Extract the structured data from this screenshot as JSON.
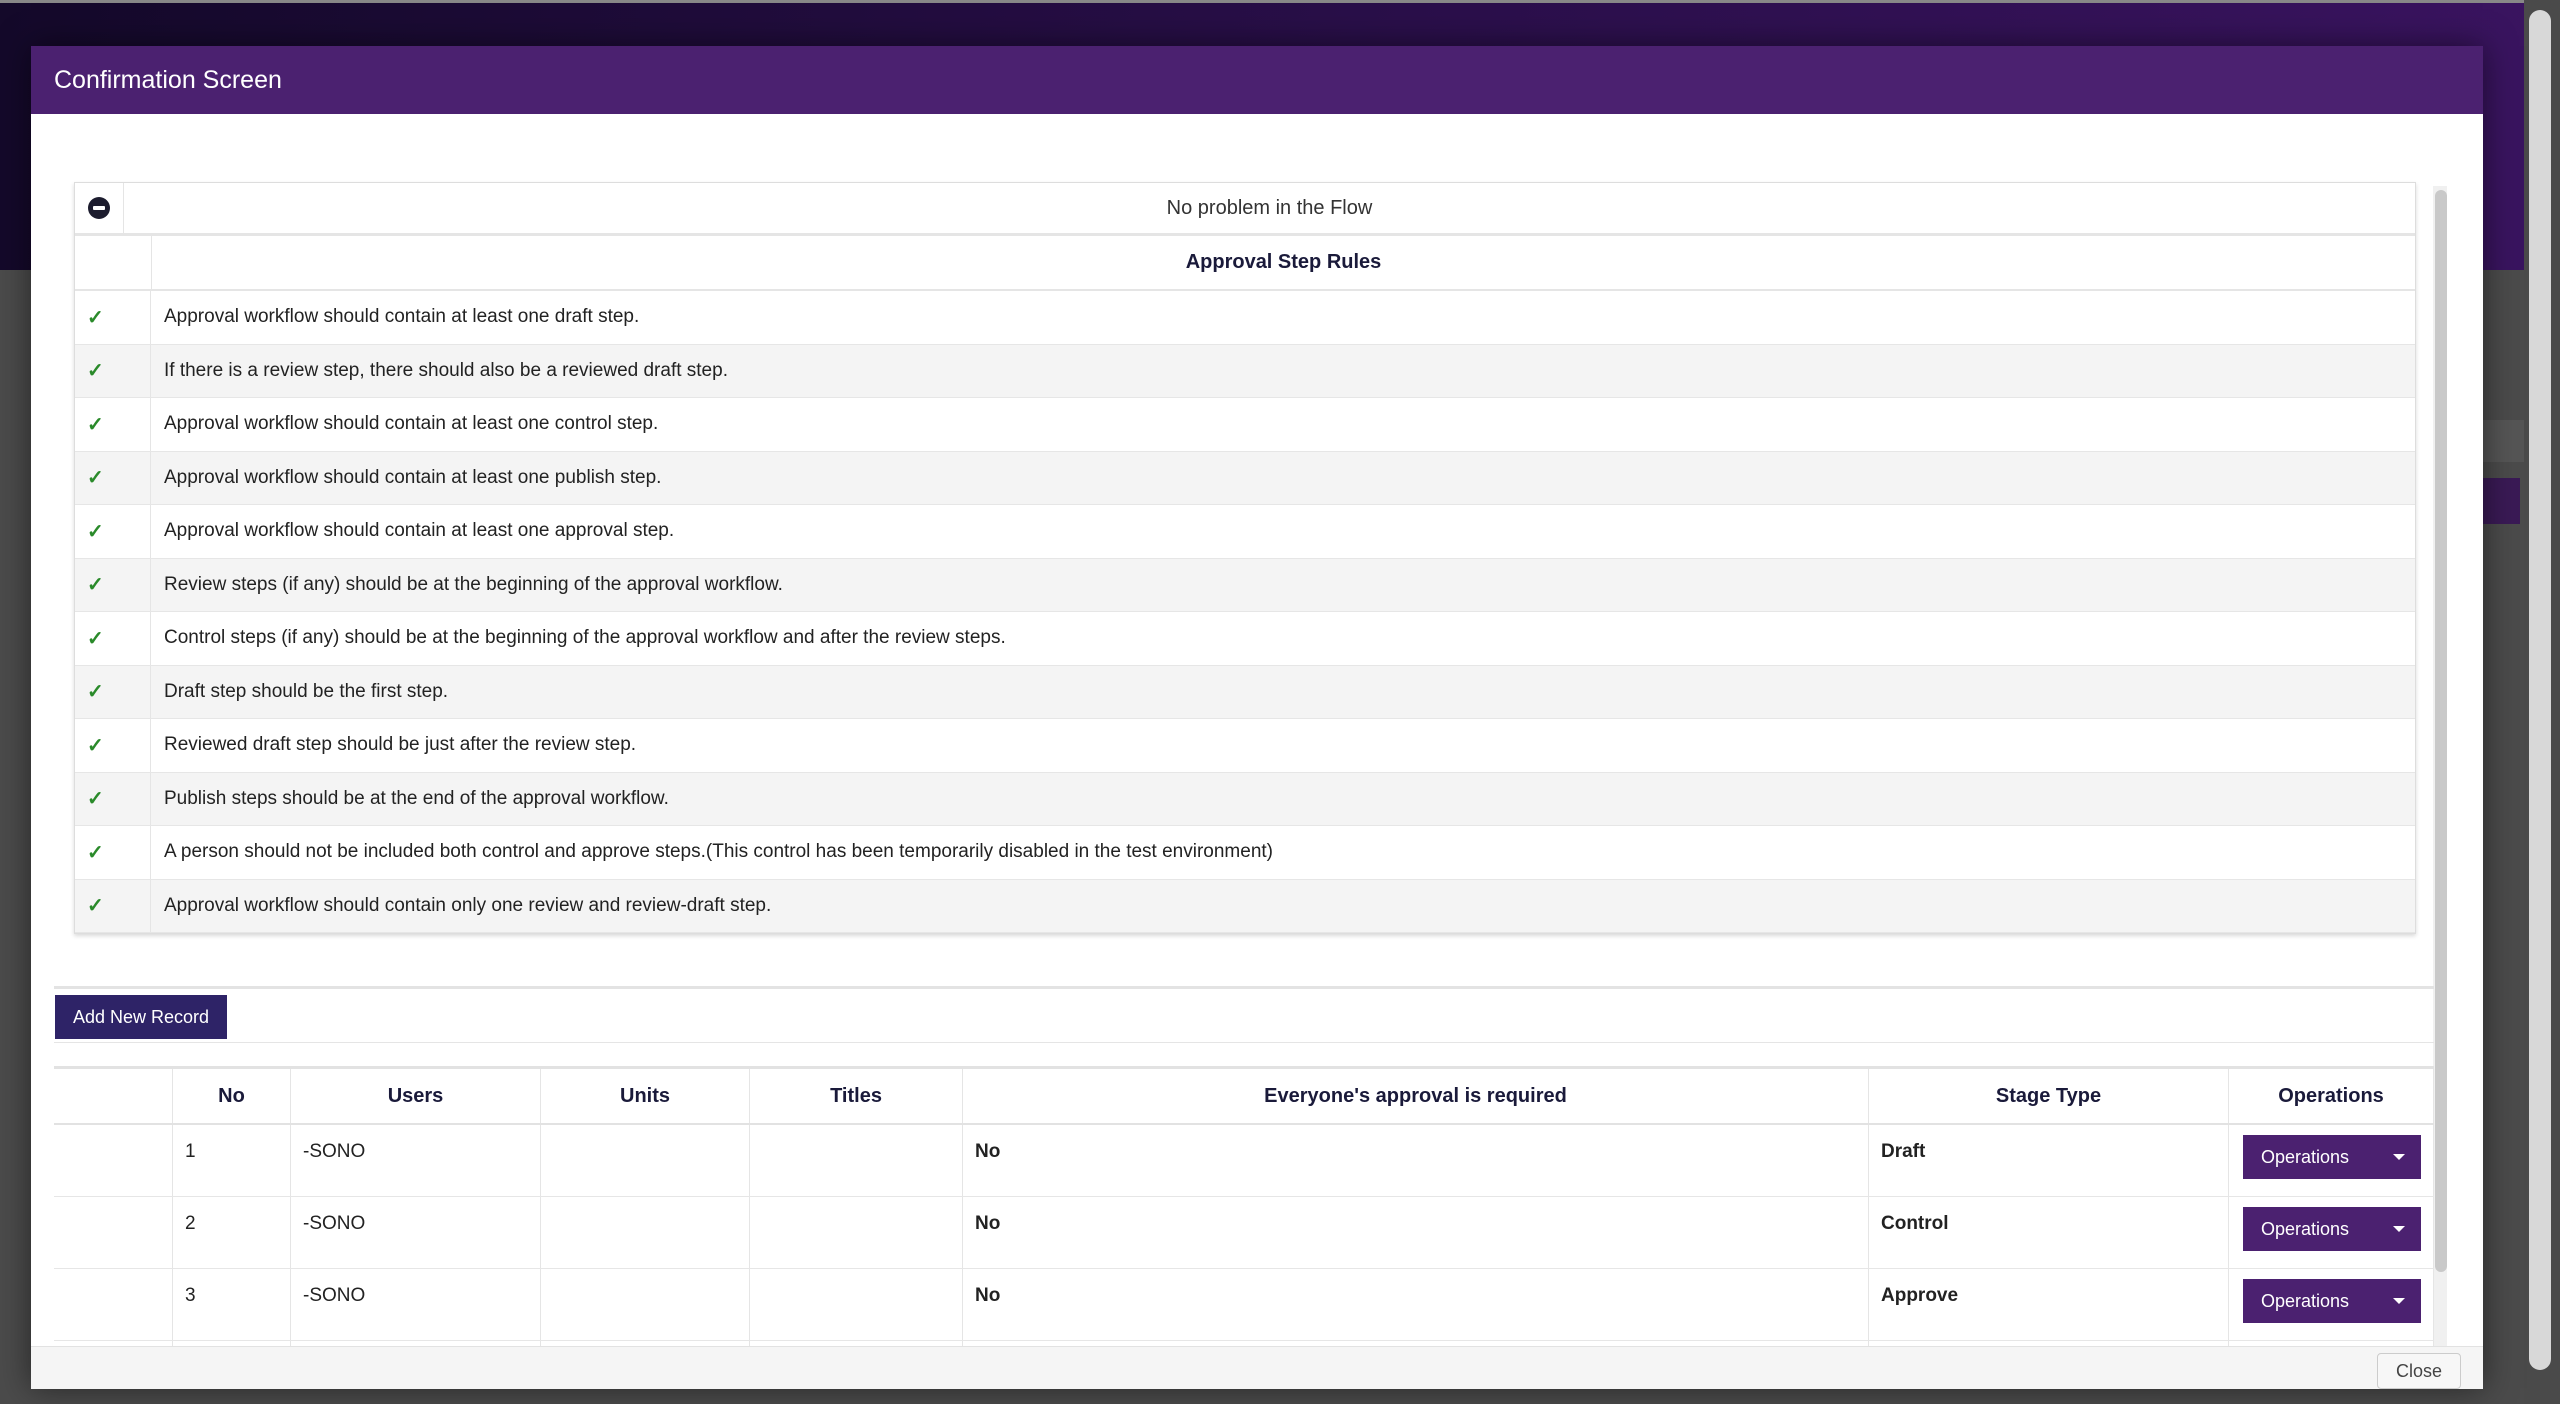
{
  "modal": {
    "title": "Confirmation Screen",
    "close_label": "Close"
  },
  "rules": {
    "status_text": "No problem in the Flow",
    "header": "Approval Step Rules",
    "check_glyph": "✓",
    "items": [
      "Approval workflow should contain at least one draft step.",
      "If there is a review step, there should also be a reviewed draft step.",
      "Approval workflow should contain at least one control step.",
      "Approval workflow should contain at least one publish step.",
      "Approval workflow should contain at least one approval step.",
      "Review steps (if any) should be at the beginning of the approval workflow.",
      "Control steps (if any) should be at the beginning of the approval workflow and after the review steps.",
      "Draft step should be the first step.",
      "Reviewed draft step should be just after the review step.",
      "Publish steps should be at the end of the approval workflow.",
      "A person should not be included both control and approve steps.(This control has been temporarily disabled in the test environment)",
      "Approval workflow should contain only one review and review-draft step."
    ]
  },
  "records": {
    "add_label": "Add New Record",
    "columns": [
      "",
      "No",
      "Users",
      "Units",
      "Titles",
      "Everyone's approval is required",
      "Stage Type",
      "Operations"
    ],
    "rows": [
      {
        "no": "1",
        "users": "-SONO",
        "units": "",
        "titles": "",
        "everyone": "No",
        "stage": "Draft",
        "ops": "Operations"
      },
      {
        "no": "2",
        "users": "-SONO",
        "units": "",
        "titles": "",
        "everyone": "No",
        "stage": "Control",
        "ops": "Operations"
      },
      {
        "no": "3",
        "users": "-SONO",
        "units": "",
        "titles": "",
        "everyone": "No",
        "stage": "Approve",
        "ops": "Operations"
      }
    ]
  },
  "colors": {
    "header_purple": "#4b2170",
    "add_button_navy": "#2e2367",
    "check_green": "#2a8a2a"
  }
}
